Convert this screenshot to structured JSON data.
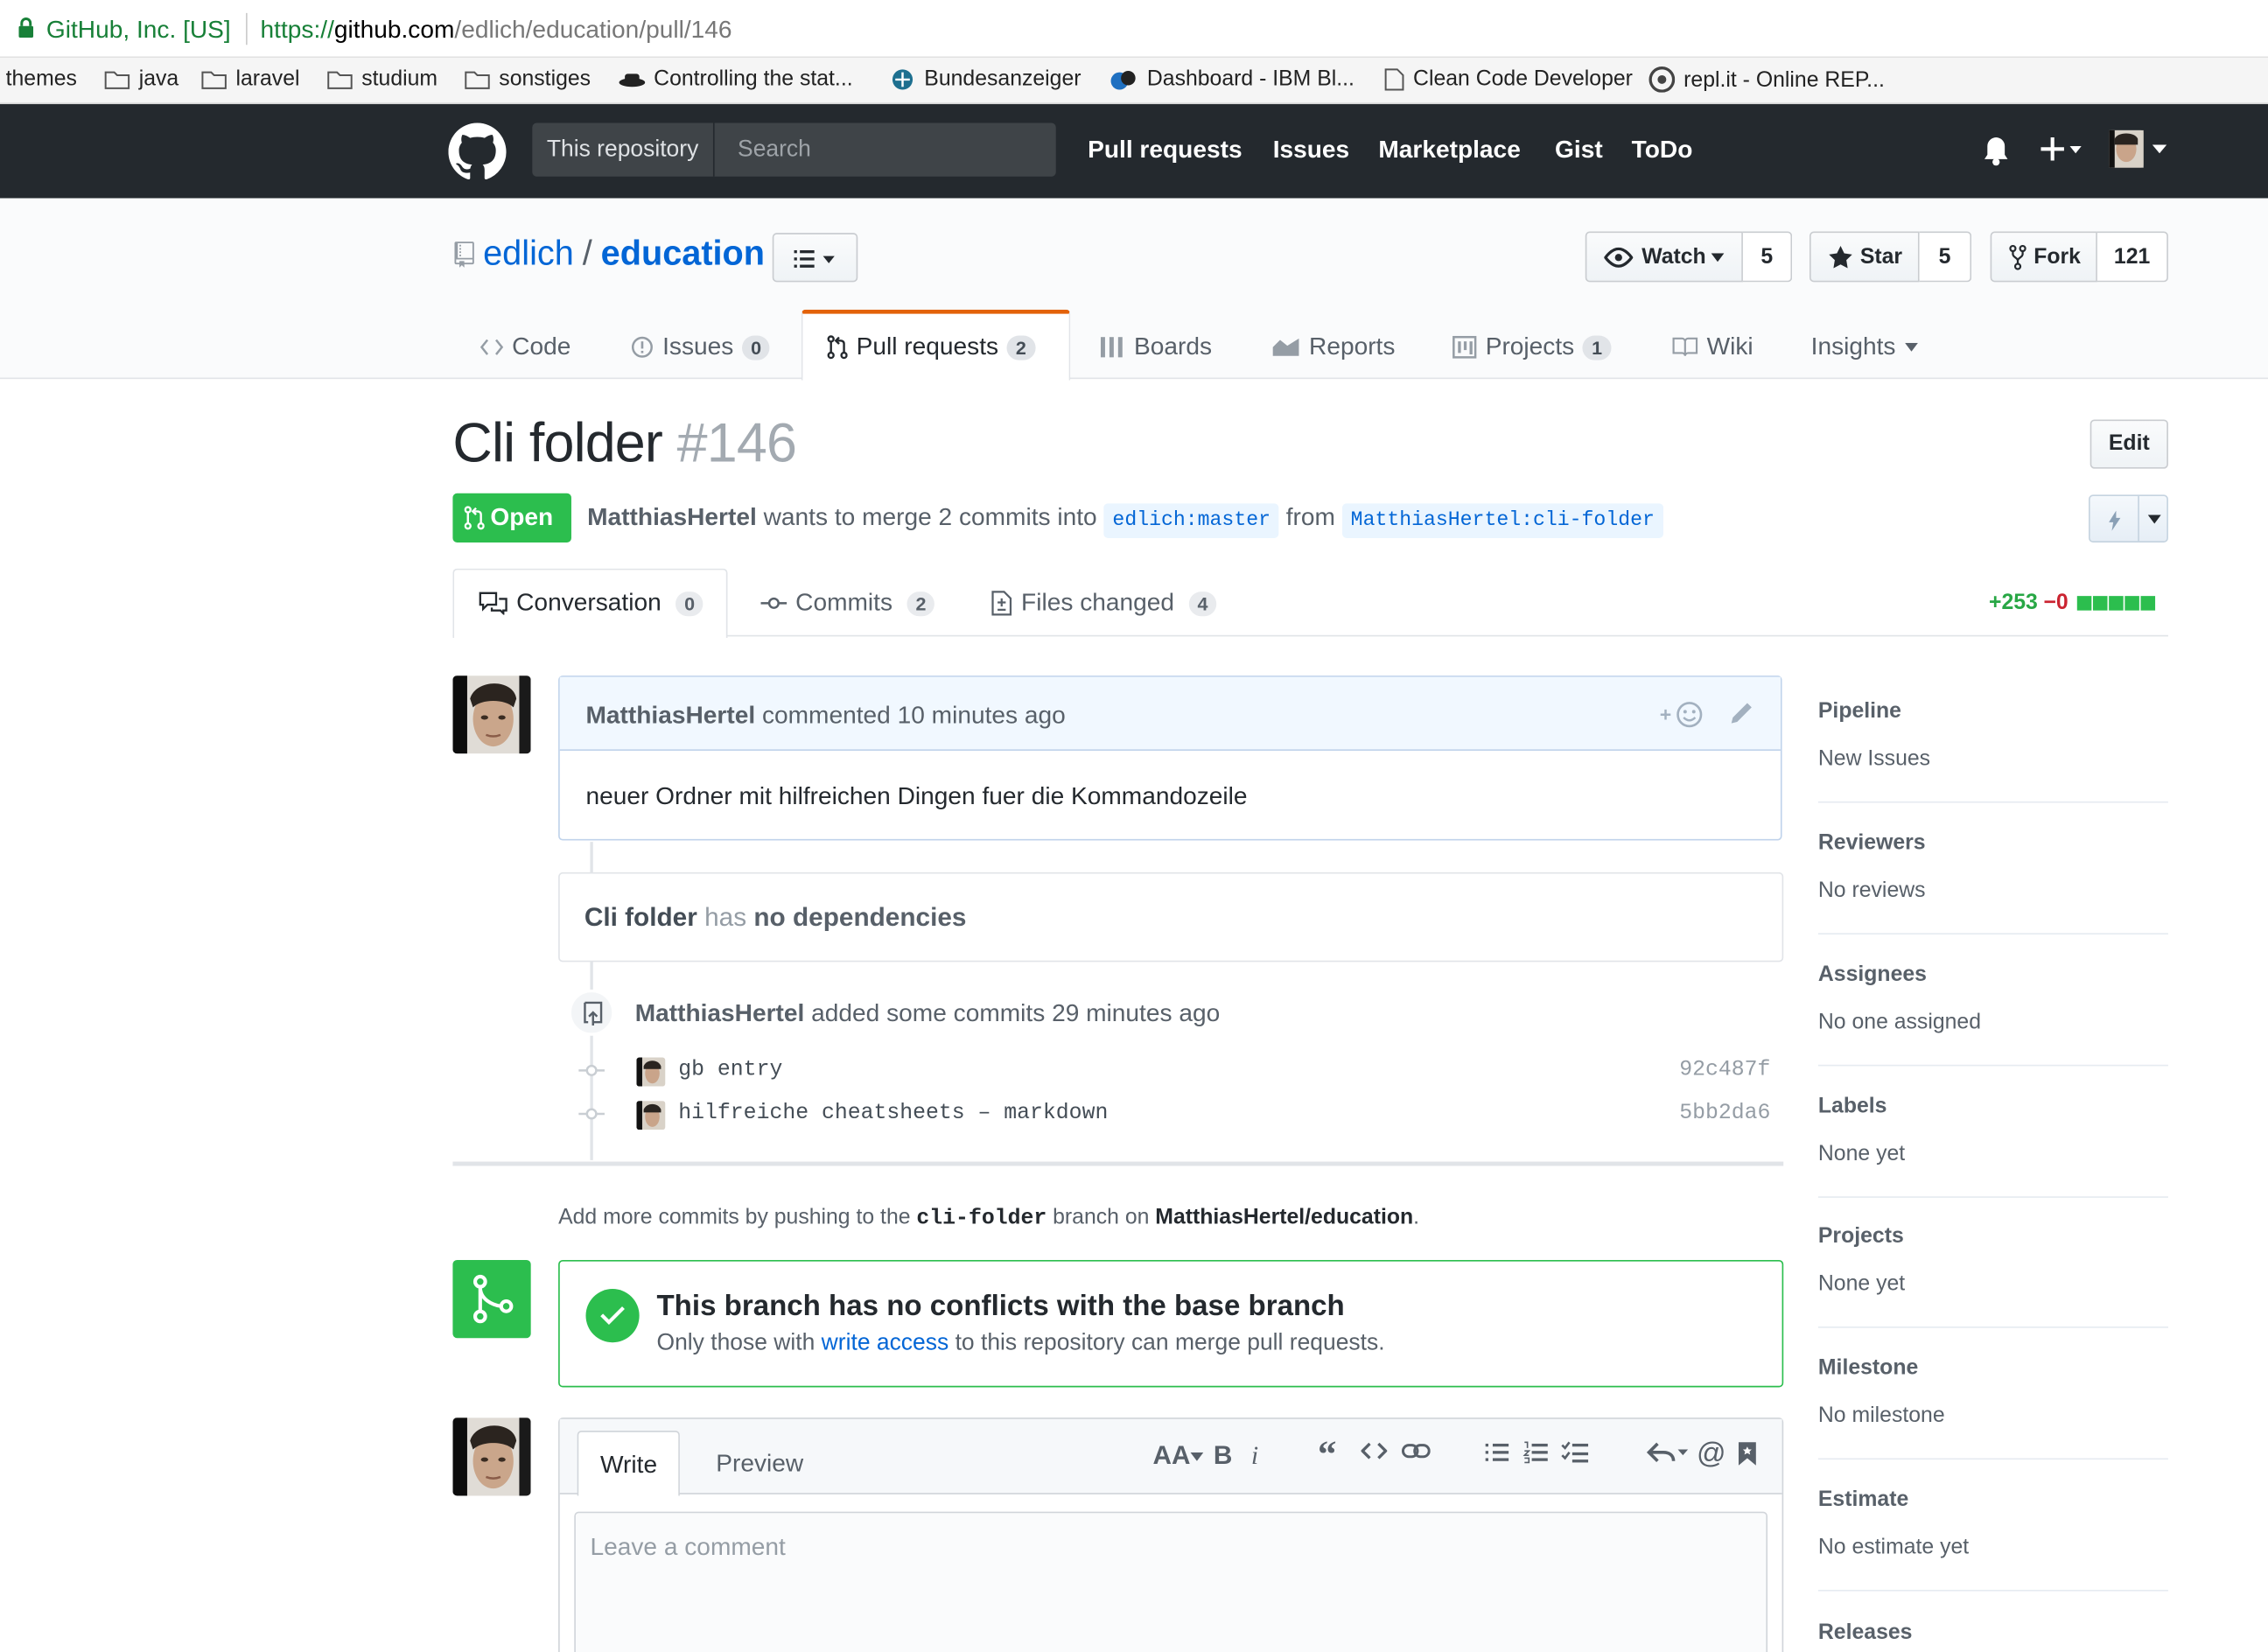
{
  "browser": {
    "secure_label": "GitHub, Inc. [US]",
    "url_scheme": "https://",
    "url_host": "github.com",
    "url_path": "/edlich/education/pull/146",
    "bookmarks": [
      "themes",
      "java",
      "laravel",
      "studium",
      "sonstiges",
      "Controlling the stat...",
      "Bundesanzeiger",
      "Dashboard - IBM Bl...",
      "Clean Code Developer",
      "repl.it - Online REP..."
    ]
  },
  "header": {
    "search_scope": "This repository",
    "search_placeholder": "Search",
    "nav": [
      "Pull requests",
      "Issues",
      "Marketplace",
      "Gist",
      "ToDo"
    ]
  },
  "repo": {
    "owner": "edlich",
    "separator": "/",
    "name": "education",
    "watch_label": "Watch",
    "watch_count": "5",
    "star_label": "Star",
    "star_count": "5",
    "fork_label": "Fork",
    "fork_count": "121",
    "tabs": [
      {
        "label": "Code"
      },
      {
        "label": "Issues",
        "count": "0"
      },
      {
        "label": "Pull requests",
        "count": "2"
      },
      {
        "label": "Boards"
      },
      {
        "label": "Reports"
      },
      {
        "label": "Projects",
        "count": "1"
      },
      {
        "label": "Wiki"
      },
      {
        "label": "Insights"
      }
    ]
  },
  "pr": {
    "title": "Cli folder",
    "number": "#146",
    "edit_label": "Edit",
    "state": "Open",
    "author": "MatthiasHertel",
    "merge_text": "wants to merge 2 commits into",
    "base_ref": "edlich:master",
    "from_text": "from",
    "head_ref": "MatthiasHertel:cli-folder",
    "tabs": [
      {
        "label": "Conversation",
        "count": "0"
      },
      {
        "label": "Commits",
        "count": "2"
      },
      {
        "label": "Files changed",
        "count": "4"
      }
    ],
    "additions": "+253",
    "deletions": "−0"
  },
  "comment": {
    "author": "MatthiasHertel",
    "action": "commented",
    "time": "10 minutes ago",
    "body": "neuer Ordner mit hilfreichen Dingen fuer die Kommandozeile"
  },
  "dependencies": {
    "title": "Cli folder",
    "has": "has",
    "status": "no dependencies"
  },
  "commits_event": {
    "author": "MatthiasHertel",
    "action": "added some commits",
    "time": "29 minutes ago",
    "commits": [
      {
        "message": "gb entry",
        "sha": "92c487f"
      },
      {
        "message": "hilfreiche cheatsheets – markdown",
        "sha": "5bb2da6"
      }
    ]
  },
  "push_hint": {
    "pre": "Add more commits by pushing to the",
    "branch": "cli-folder",
    "mid": "branch on",
    "repo": "MatthiasHertel/education",
    "post": "."
  },
  "merge": {
    "title": "This branch has no conflicts with the base branch",
    "desc_pre": "Only those with",
    "desc_link": "write access",
    "desc_post": "to this repository can merge pull requests."
  },
  "editor": {
    "write_tab": "Write",
    "preview_tab": "Preview",
    "placeholder": "Leave a comment"
  },
  "sidebar": [
    {
      "heading": "Pipeline",
      "value": "New Issues"
    },
    {
      "heading": "Reviewers",
      "value": "No reviews"
    },
    {
      "heading": "Assignees",
      "value": "No one assigned"
    },
    {
      "heading": "Labels",
      "value": "None yet"
    },
    {
      "heading": "Projects",
      "value": "None yet"
    },
    {
      "heading": "Milestone",
      "value": "No milestone"
    },
    {
      "heading": "Estimate",
      "value": "No estimate yet"
    },
    {
      "heading": "Releases",
      "value": ""
    }
  ],
  "colors": {
    "header_bg": "#24292e",
    "link": "#0366d6",
    "open_green": "#2cbe4e",
    "tab_accent": "#e36209",
    "deletion_red": "#cb2431",
    "addition_green": "#28a745"
  }
}
